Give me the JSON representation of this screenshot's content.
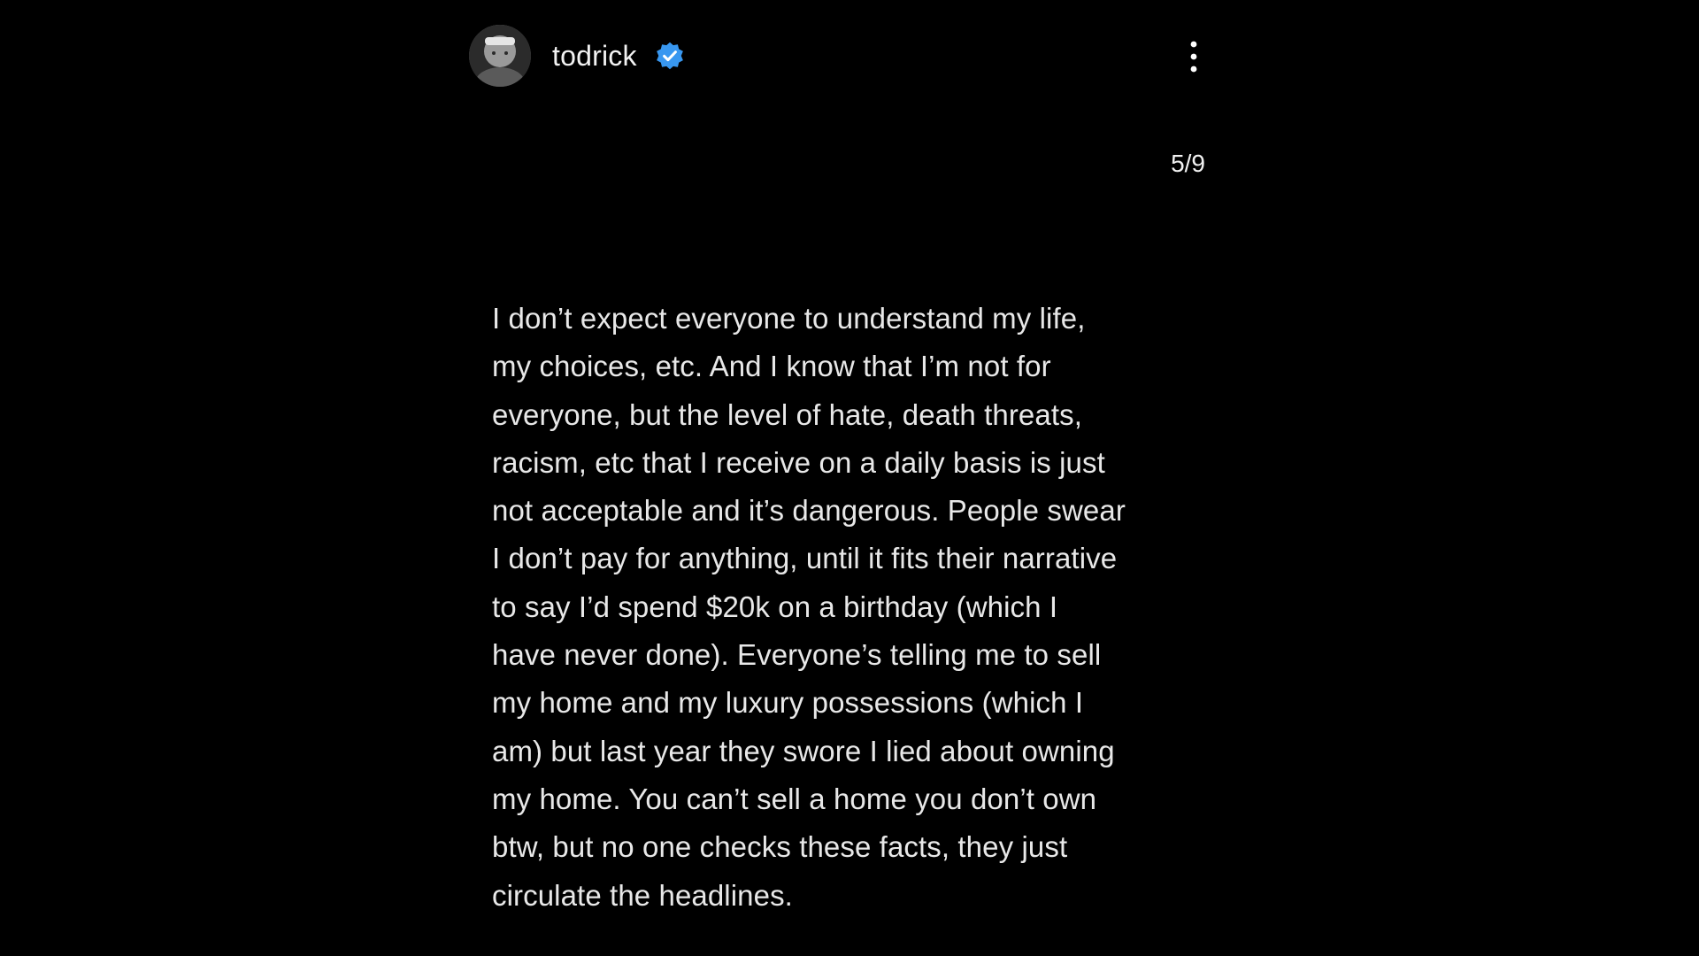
{
  "post": {
    "author": {
      "username": "todrick",
      "verified": true,
      "verified_color": "#3897f0",
      "avatar_icon": "profile-photo"
    },
    "menu_icon": "more-vertical-icon",
    "page_counter": "5/9",
    "caption_lines": [
      "I don’t expect everyone to understand my life,",
      "my choices, etc. And I know that I’m not for",
      "everyone, but the level of hate, death threats,",
      "racism, etc that I receive on a daily basis is just",
      "not acceptable and it’s dangerous. People swear",
      "I don’t pay for anything, until it fits their narrative",
      "to say I’d spend $20k on a birthday (which I",
      "have never done). Everyone’s telling me to sell",
      "my home and my luxury possessions (which I",
      "am) but last year they swore I lied about owning",
      "my home. You can’t sell a home you don’t own",
      "btw, but no one checks these facts, they just",
      "circulate the headlines."
    ]
  },
  "colors": {
    "background": "#000000",
    "text": "#e8e8e8"
  }
}
